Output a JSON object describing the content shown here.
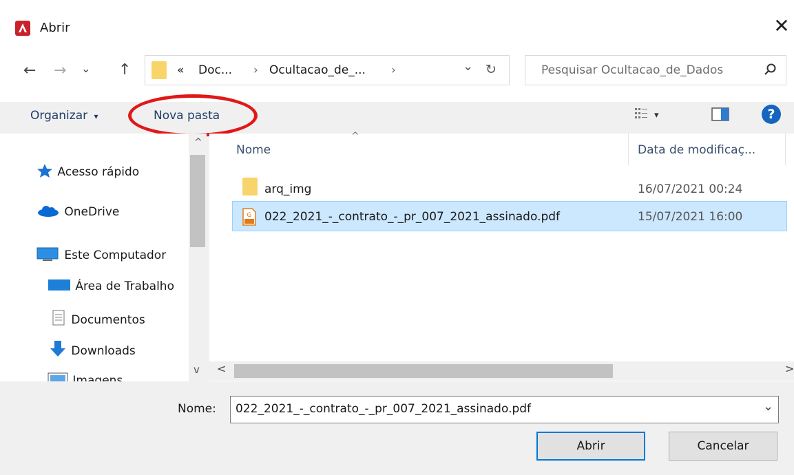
{
  "window": {
    "title": "Abrir",
    "close_glyph": "✕",
    "app_icon": "pdf-app-icon"
  },
  "nav": {
    "back": "←",
    "forward": "→",
    "recent": "⌄",
    "up": "↑",
    "breadcrumb": {
      "prefix": "«",
      "segments": [
        "Doc...",
        "Ocultacao_de_..."
      ],
      "separator": "›"
    },
    "dropdown_glyph": "⌄",
    "refresh_glyph": "↻",
    "search_placeholder": "Pesquisar Ocultacao_de_Dados"
  },
  "toolbar": {
    "organize": "Organizar",
    "organize_arrow": "▾",
    "new_folder": "Nova pasta",
    "view_arrow": "▾",
    "help": "?"
  },
  "sidebar": {
    "items": [
      {
        "label": "Acesso rápido",
        "icon": "star-icon"
      },
      {
        "label": "OneDrive",
        "icon": "cloud-icon"
      },
      {
        "label": "Este Computador",
        "icon": "computer-icon"
      },
      {
        "label": "Área de Trabalho",
        "icon": "desktop-icon"
      },
      {
        "label": "Documentos",
        "icon": "document-icon"
      },
      {
        "label": "Downloads",
        "icon": "download-icon"
      },
      {
        "label": "Imagens",
        "icon": "pictures-icon"
      }
    ],
    "scroll_up": "^",
    "scroll_down": "v"
  },
  "file_list": {
    "sort_glyph": "^",
    "columns": [
      "Nome",
      "Data de modificaç..."
    ],
    "rows": [
      {
        "name": "arq_img",
        "date": "16/07/2021 00:24",
        "type": "folder",
        "selected": false
      },
      {
        "name": "022_2021_-_contrato_-_pr_007_2021_assinado.pdf",
        "date": "15/07/2021 16:00",
        "type": "pdf",
        "selected": true
      }
    ],
    "scroll_left": "<",
    "scroll_right": ">"
  },
  "footer": {
    "name_label": "Nome:",
    "name_value": "022_2021_-_contrato_-_pr_007_2021_assinado.pdf",
    "dropdown_glyph": "⌄",
    "open_label": "Abrir",
    "cancel_label": "Cancelar"
  },
  "colors": {
    "selection": "#cce8ff",
    "annotation": "#e01818",
    "accent": "#0078d7",
    "folder": "#f7d56b"
  }
}
